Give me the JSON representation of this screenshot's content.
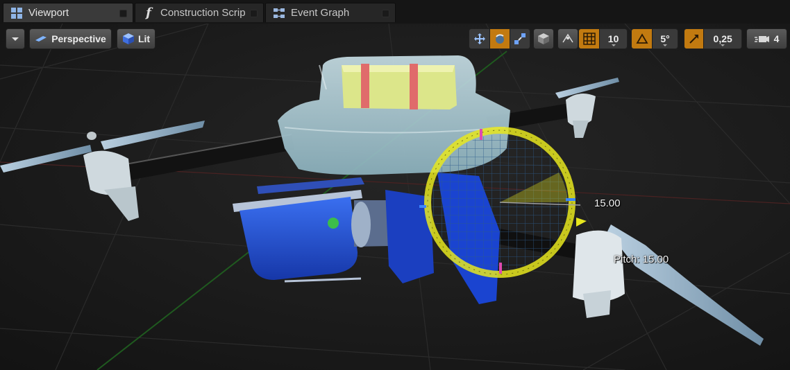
{
  "tabs": [
    {
      "label": "Viewport",
      "icon": "viewport-icon",
      "active": true
    },
    {
      "label": "Construction Scrip",
      "icon": "function-icon",
      "active": false
    },
    {
      "label": "Event Graph",
      "icon": "graph-icon",
      "active": false
    }
  ],
  "toolbar": {
    "view_mode_label": "Perspective",
    "lit_label": "Lit",
    "grid_snap_value": "10",
    "rotation_snap_value": "5°",
    "scale_snap_value": "0,25",
    "camera_speed_value": "4"
  },
  "gizmo": {
    "angle_readout": "15.00",
    "pitch_readout": "Pitch: 15.00"
  },
  "colors": {
    "accent": "#c27a10",
    "gizmo": "#e6e61e",
    "drone_body": "#9fc4cf",
    "camera_blue": "#1f4fd6"
  }
}
